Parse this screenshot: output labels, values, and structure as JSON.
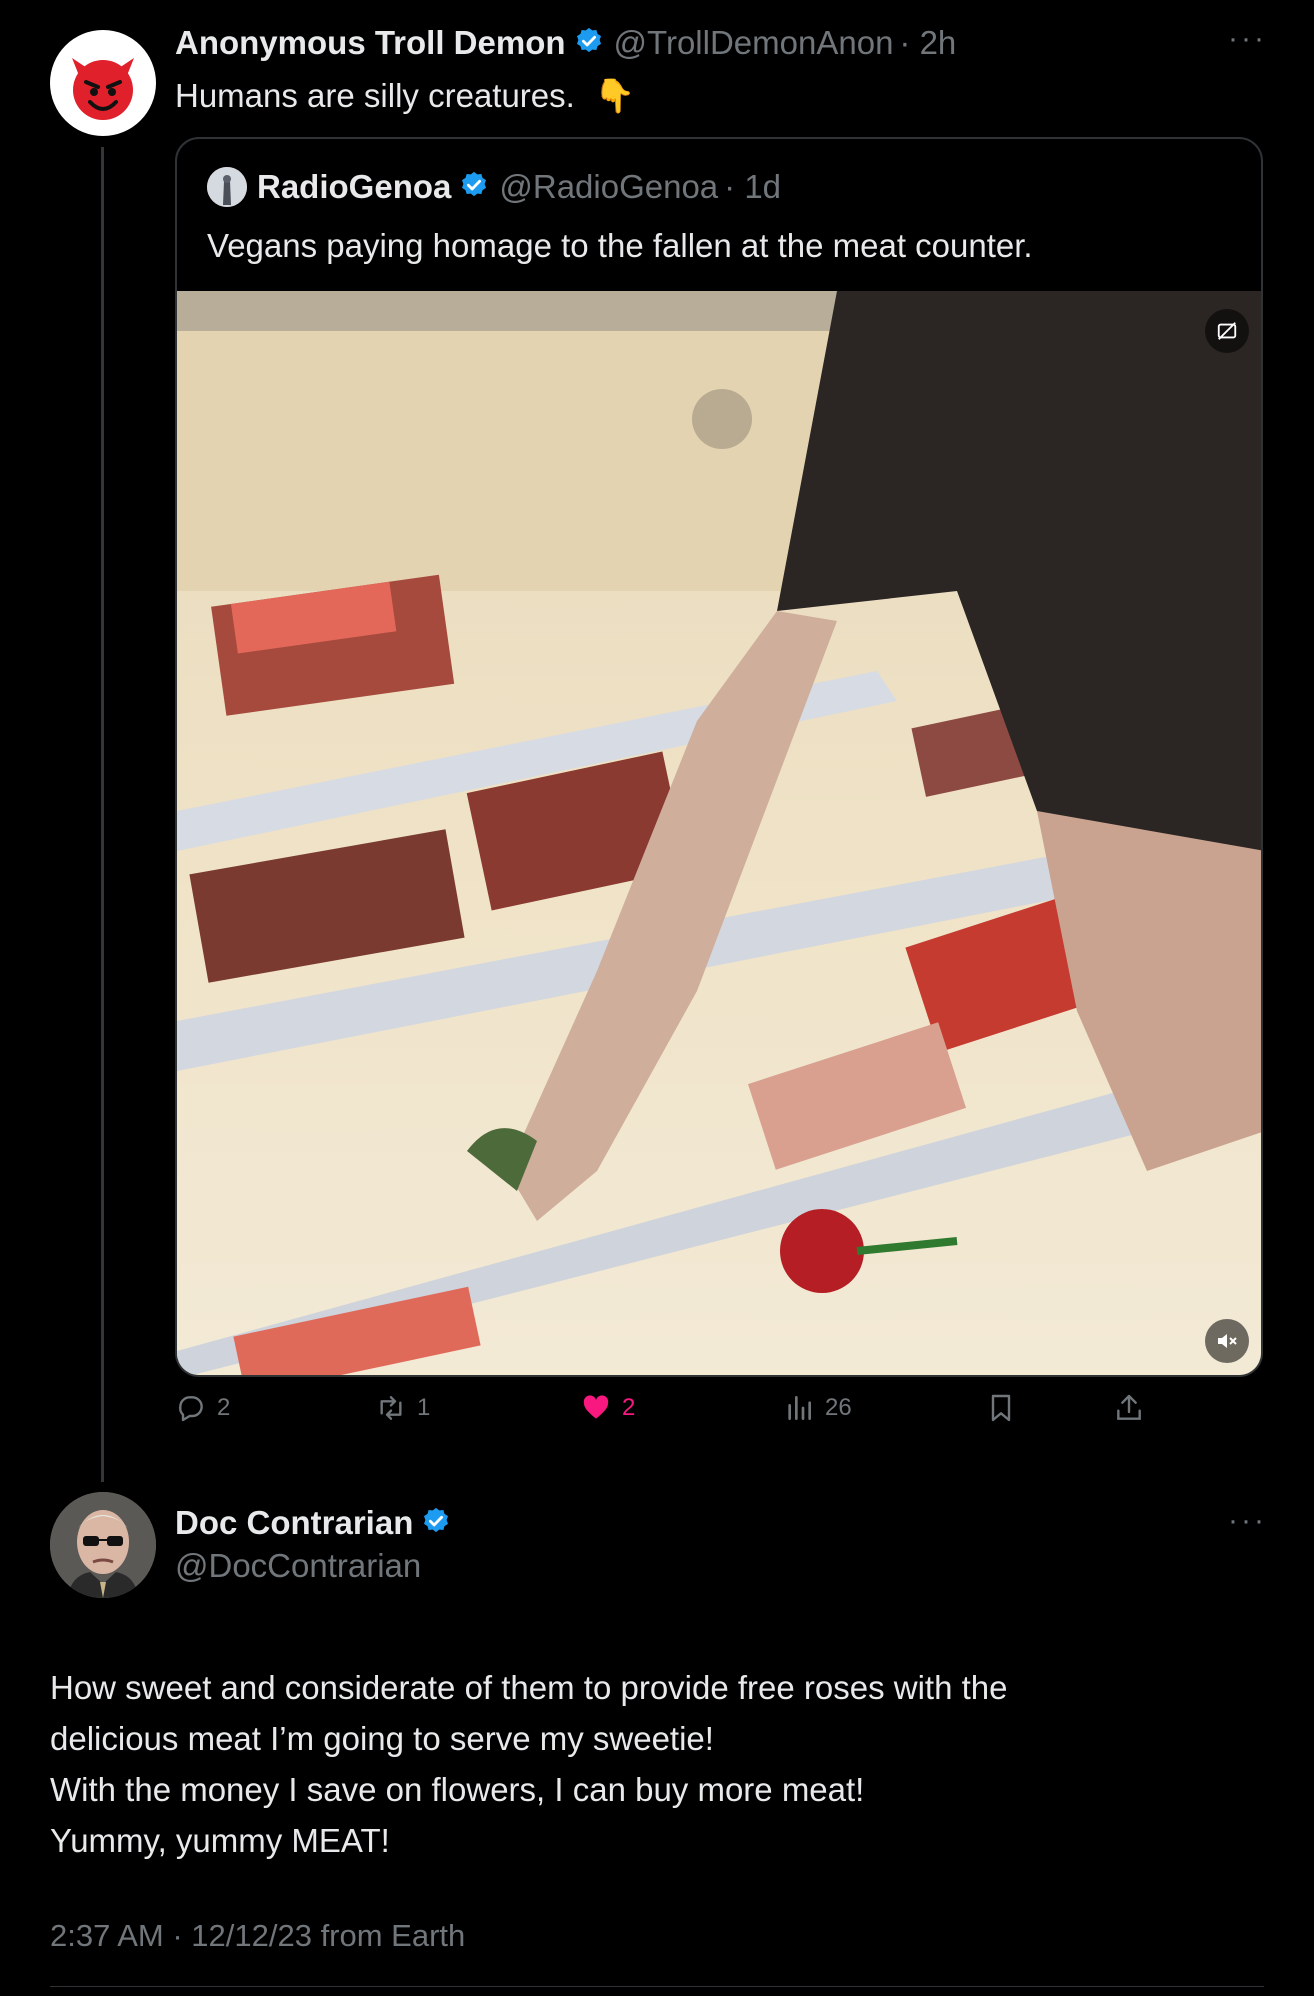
{
  "tweet1": {
    "name": "Anonymous Troll Demon",
    "handle": "@TrollDemonAnon",
    "time": "· 2h",
    "text": "Humans are silly creatures.",
    "emoji": "👇",
    "avatar_icon": "smiling-devil-icon"
  },
  "quote": {
    "name": "RadioGenoa",
    "handle": "@RadioGenoa",
    "time": "· 1d",
    "text": "Vegans paying homage to the fallen at the meat counter."
  },
  "actions": {
    "replies": "2",
    "reposts": "1",
    "likes": "2",
    "views": "26"
  },
  "tweet2": {
    "name": "Doc Contrarian",
    "handle": "@DocContrarian",
    "lines": [
      "How sweet and considerate of them to provide free roses with the",
      "delicious meat I’m going to serve my sweetie!",
      "With the money I save on flowers, I can buy more meat!",
      "Yummy, yummy MEAT!"
    ],
    "timestamp": "2:37 AM · 12/12/23 from Earth"
  },
  "colors": {
    "background": "#000000",
    "text": "#e7e9ea",
    "muted": "#71767b",
    "verified": "#1d9bf0",
    "like": "#f91880"
  }
}
